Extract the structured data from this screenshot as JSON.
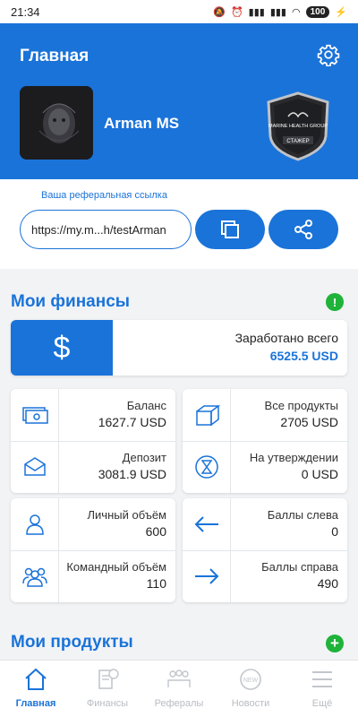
{
  "status": {
    "time": "21:34",
    "battery": "100"
  },
  "header": {
    "title": "Главная",
    "user_name": "Arman MS",
    "badge_text": "MARINE HEALTH GROUP",
    "badge_rank": "СТАЖЕР"
  },
  "referral": {
    "label": "Ваша реферальная ссылка",
    "link": "https://my.m...h/testArman"
  },
  "finance": {
    "title": "Мои финансы",
    "info_icon": "!",
    "earned_label": "Заработано всего",
    "earned_value": "6525.5 USD",
    "balance_label": "Баланс",
    "balance_value": "1627.7 USD",
    "deposit_label": "Депозит",
    "deposit_value": "3081.9 USD",
    "products_label": "Все продукты",
    "products_value": "2705 USD",
    "pending_label": "На утверждении",
    "pending_value": "0 USD",
    "personal_label": "Личный объём",
    "personal_value": "600",
    "team_label": "Командный объём",
    "team_value": "110",
    "left_label": "Баллы слева",
    "left_value": "0",
    "right_label": "Баллы справа",
    "right_value": "490"
  },
  "products": {
    "title": "Мои продукты",
    "add_icon": "+"
  },
  "nav": {
    "home": "Главная",
    "finance": "Финансы",
    "referrals": "Рефералы",
    "news": "Новости",
    "more": "Ещё"
  },
  "colors": {
    "primary": "#1a73d9",
    "green": "#1fb33a"
  }
}
